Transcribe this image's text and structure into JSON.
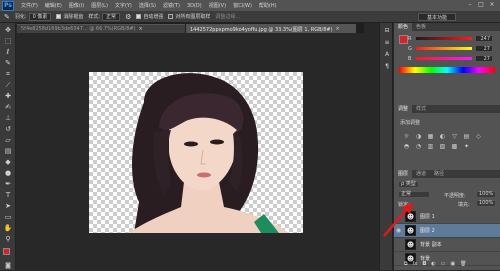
{
  "menubar": {
    "logo": "Ps",
    "items": [
      "文件(F)",
      "编辑(E)",
      "图像(I)",
      "图层(L)",
      "文字(Y)",
      "选择(S)",
      "滤镜(T)",
      "3D(D)",
      "视图(V)",
      "窗口(W)",
      "帮助(H)"
    ],
    "win_minimize": "–",
    "win_maximize": "□",
    "win_close": "×"
  },
  "options": {
    "feather_label": "羽化:",
    "feather_value": "0 像素",
    "antialias": "消除锯齿",
    "style_label": "样式:",
    "style_value": "正常",
    "refine": "调整边缘...",
    "auto_enhance": "自动增强",
    "sample_all": "对所有图层取样",
    "workspace": "基本功能"
  },
  "tabs": [
    {
      "title": "5f4e8258d169b3de6347... @ 66.7%(RGB/8#)",
      "close": "×"
    },
    {
      "title": "1442572ppxpmo9ko4yoffu.jpg @ 33.3%(图层 1, RGB/8#)",
      "close": "×"
    }
  ],
  "panels": {
    "color_tabs": [
      "颜色",
      "色板"
    ],
    "colors": {
      "fg": "#e02020",
      "bg": "#ffffff",
      "accent": "#5e7b99"
    },
    "sliders": [
      {
        "label": "R",
        "value": "247"
      },
      {
        "label": "G",
        "value": "27"
      },
      {
        "label": "B",
        "value": "27"
      }
    ],
    "adjust_tabs": [
      "调整",
      "样式"
    ],
    "adjust_title": "添加调整",
    "adjust_icons": [
      "☼",
      "◑",
      "▦",
      "◐",
      "▽",
      "▤",
      "◇",
      "◓",
      "◔",
      "▥",
      "▧",
      "▩",
      "✦"
    ],
    "layers_tabs": [
      "图层",
      "通道",
      "路径"
    ],
    "kind_label": "ρ 类型",
    "blend_mode": "正常",
    "opacity_label": "不透明度:",
    "opacity_value": "100%",
    "lock_label": "锁定:",
    "fill_label": "填充:",
    "fill_value": "100%",
    "layers": [
      {
        "name": "图层 1",
        "eye": "",
        "thumb": "☻"
      },
      {
        "name": "图层 2",
        "eye": "◉",
        "thumb": "☻"
      },
      {
        "name": "背景 副本",
        "eye": "",
        "thumb": "☻"
      },
      {
        "name": "背景",
        "eye": "",
        "thumb": "☻"
      }
    ],
    "footer_icons": [
      "⧉",
      "fx",
      "◘",
      "◐",
      "▭",
      "▣",
      "🗑"
    ]
  }
}
